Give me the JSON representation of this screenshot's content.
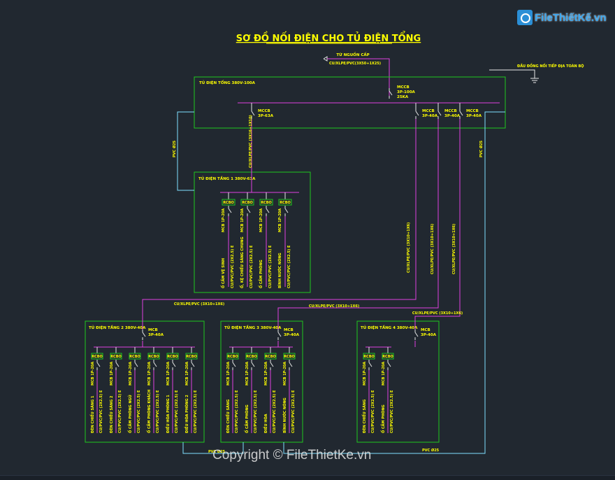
{
  "title": "SƠ ĐỒ NỐI ĐIỆN CHO TỦ ĐIỆN TỔNG",
  "watermark": {
    "logo": "FileThiếtKế.vn",
    "copyright": "Copyright © FileThietKe.vn"
  },
  "feed": {
    "label": "TỪ NGUỒN CẤP",
    "cable": "CU/XLPE/PVC(3X50+1X25)"
  },
  "earth": {
    "label": "ĐẦU ĐỒNG NỐI TIẾP ĐỊA TOÀN BỘ"
  },
  "main_panel": {
    "title": "TỦ ĐIỆN TỔNG 380V-100A",
    "main_breaker": [
      "MCCB",
      "3P-100A",
      "25KA"
    ],
    "outgoing": [
      [
        "MCCB",
        "3P-63A"
      ],
      [
        "MCCB",
        "3P-40A"
      ],
      [
        "MCCB",
        "3P-40A"
      ],
      [
        "MCCB",
        "3P-40A"
      ]
    ]
  },
  "cables": {
    "to_floor1": "CU/XLPE/PVC (3X16+1X10)",
    "to_floor2": "CU/XLPE/PVC (3X10+1X6)",
    "to_floor3": "CU/XLPE/PVC (3X10+1X6)",
    "to_floor4": "CU/XLPE/PVC (3X10+1X6)",
    "pvc_left": "PVC Ø25",
    "pvc_right": "PVC Ø25",
    "pvc_bottom_left": "PVC Ø25",
    "pvc_bottom_right": "PVC Ø25"
  },
  "sub_panels": [
    {
      "title": "TỦ ĐIỆN TẦNG 1 380V-63A",
      "breaker": [
        "MCB",
        "3P-63A"
      ],
      "rcbo_label": "RCBO",
      "circuits": [
        {
          "mcb": "MCB 1P-20A",
          "cable": "CU/PVC/PVC (2X2.5) E",
          "load": "Ổ CẮM VỆ SINH"
        },
        {
          "mcb": "MCB 1P-20A",
          "cable": "CU/PVC/PVC (2X2.5) E",
          "load": "Ổ, KỆ CHIẾU SÁNG CHUNG"
        },
        {
          "mcb": "MCB 1P-20A",
          "cable": "CU/PVC/PVC (2X2.5) E",
          "load": "Ổ CẮM PHÒNG"
        },
        {
          "mcb": "MCB 1P-20A",
          "cable": "CU/PVC/PVC (2X2.5) E",
          "load": "BÌNH NƯỚC NÓNG"
        }
      ]
    },
    {
      "title": "TỦ ĐIỆN TẦNG 2 380V-40A",
      "breaker": [
        "MCB",
        "3P-40A"
      ],
      "rcbo_label": "RCBO",
      "circuits": [
        {
          "mcb": "MCB 1P-20A",
          "cable": "CU/PVC/PVC (2X2.5) E",
          "load": "ĐÈN CHIẾU SÁNG 1"
        },
        {
          "mcb": "MCB 1P-20A",
          "cable": "CU/PVC/PVC (2X2.5) E",
          "load": "ĐÈN CHIẾU SÁNG 2"
        },
        {
          "mcb": "MCB 1P-20A",
          "cable": "CU/PVC/PVC (2X2.5) E",
          "load": "Ổ CẮM PHÒNG NGỦ"
        },
        {
          "mcb": "MCB 1P-20A",
          "cable": "CU/PVC/PVC (2X2.5) E",
          "load": "Ổ CẮM PHÒNG KHÁCH"
        },
        {
          "mcb": "MCB 1P-20A",
          "cable": "CU/PVC/PVC (2X2.5) E",
          "load": "ĐIỀU HÒA PHÒNG 1"
        },
        {
          "mcb": "MCB 1P-20A",
          "cable": "CU/PVC/PVC (2X2.5) E",
          "load": "ĐIỀU HÒA PHÒNG 2"
        }
      ]
    },
    {
      "title": "TỦ ĐIỆN TẦNG 3 380V-40A",
      "breaker": [
        "MCB",
        "3P-40A"
      ],
      "rcbo_label": "RCBO",
      "circuits": [
        {
          "mcb": "MCB 1P-20A",
          "cable": "CU/PVC/PVC (2X2.5) E",
          "load": "ĐÈN CHIẾU SÁNG"
        },
        {
          "mcb": "MCB 1P-20A",
          "cable": "CU/PVC/PVC (2X2.5) E",
          "load": "Ổ CẮM PHÒNG"
        },
        {
          "mcb": "MCB 1P-20A",
          "cable": "CU/PVC/PVC (2X2.5) E",
          "load": "ĐIỀU HÒA"
        },
        {
          "mcb": "MCB 1P-20A",
          "cable": "CU/PVC/PVC (2X2.5) E",
          "load": "BÌNH NƯỚC NÓNG"
        }
      ]
    },
    {
      "title": "TỦ ĐIỆN TẦNG 4 380V-40A",
      "breaker": [
        "MCB",
        "3P-40A"
      ],
      "rcbo_label": "RCBO",
      "circuits": [
        {
          "mcb": "MCB 1P-20A",
          "cable": "CU/PVC/PVC (2X2.5) E",
          "load": "ĐÈN CHIẾU SÁNG"
        },
        {
          "mcb": "MCB 1P-20A",
          "cable": "CU/PVC/PVC (2X2.5) E",
          "load": "Ổ CẮM PHÒNG"
        }
      ]
    }
  ],
  "colors": {
    "panel": "#1ec81e",
    "bus": "#e040e0",
    "text": "#ffff00",
    "cyan": "#7fe0ff",
    "white": "#e8e8e8"
  }
}
